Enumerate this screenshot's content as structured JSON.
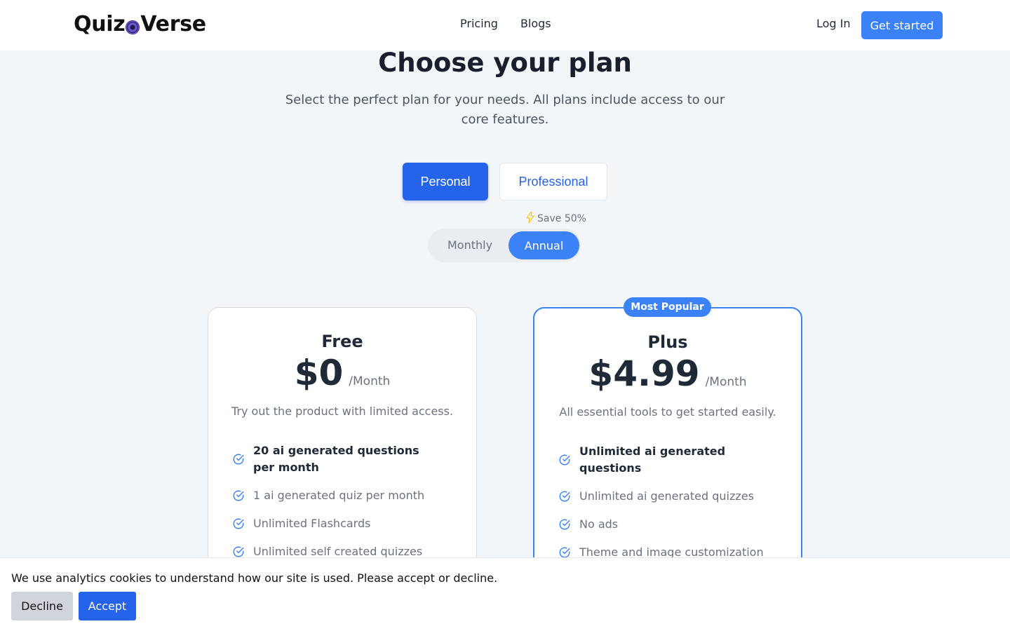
{
  "header": {
    "logo_left": "Quiz",
    "logo_right": "Verse",
    "nav": [
      "Pricing",
      "Blogs"
    ],
    "login": "Log In",
    "cta": "Get started"
  },
  "hero": {
    "title": "Choose your plan",
    "subtitle": "Select the perfect plan for your needs. All plans include access to our core features."
  },
  "audience_toggle": {
    "options": [
      "Personal",
      "Professional"
    ],
    "selected": "Personal"
  },
  "billing": {
    "save_label": "Save 50%",
    "monthly": "Monthly",
    "annual": "Annual",
    "selected": "Annual"
  },
  "plans": [
    {
      "name": "Free",
      "price": "$0",
      "period": "/Month",
      "description": "Try out the product with limited access.",
      "features": [
        {
          "text": "20 ai generated questions per month",
          "bold": true
        },
        {
          "text": "1 ai generated quiz per month",
          "bold": false
        },
        {
          "text": "Unlimited Flashcards",
          "bold": false
        },
        {
          "text": "Unlimited self created quizzes",
          "bold": false
        }
      ]
    },
    {
      "name": "Plus",
      "badge": "Most Popular",
      "price": "$4.99",
      "period": "/Month",
      "description": "All essential tools to get started easily.",
      "features": [
        {
          "text": "Unlimited ai generated questions",
          "bold": true
        },
        {
          "text": "Unlimited ai generated quizzes",
          "bold": false
        },
        {
          "text": "No ads",
          "bold": false
        },
        {
          "text": "Theme and image customization",
          "bold": false
        }
      ]
    }
  ],
  "cookie": {
    "message": "We use analytics cookies to understand how our site is used. Please accept or decline.",
    "decline": "Decline",
    "accept": "Accept"
  },
  "colors": {
    "primary": "#2563eb",
    "accent": "#3b82f6",
    "background": "#f3f6f9"
  }
}
